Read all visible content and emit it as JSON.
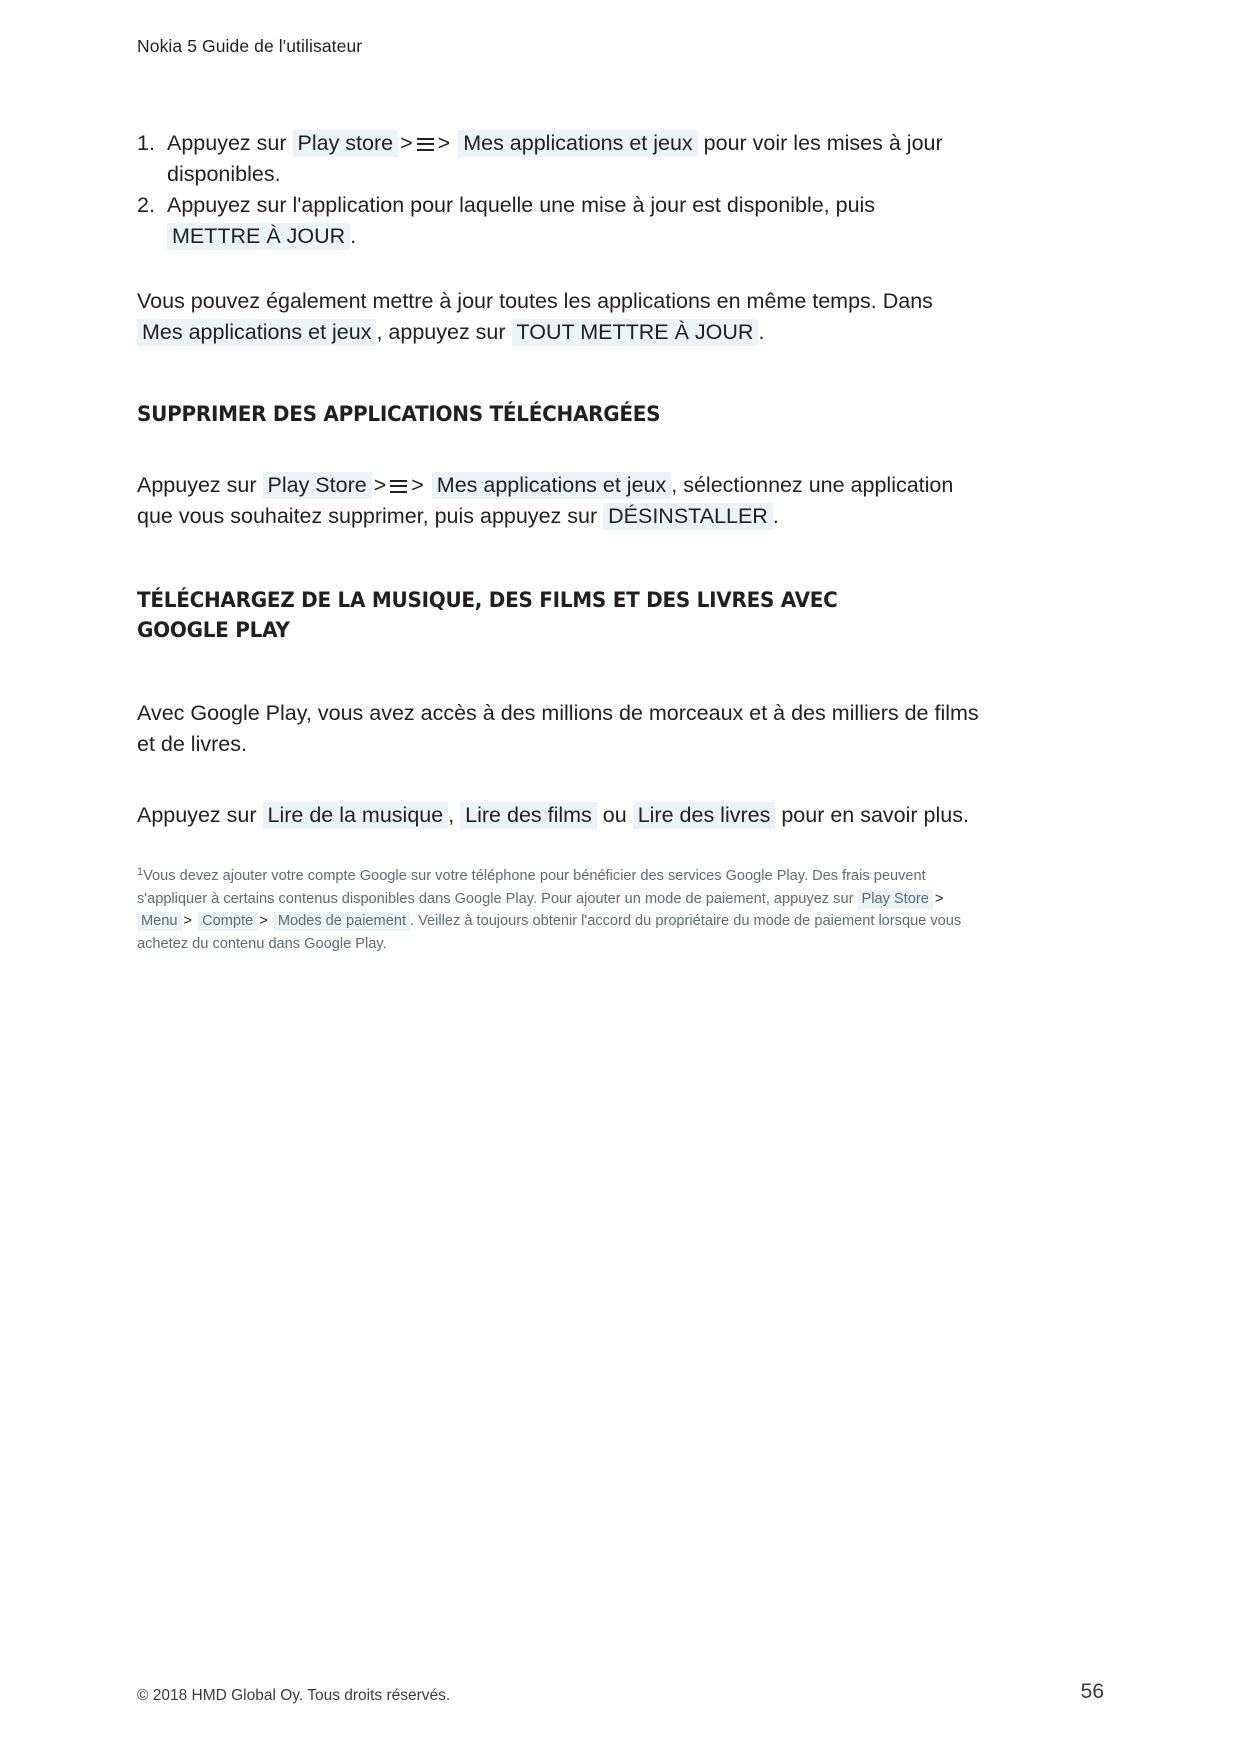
{
  "header": {
    "title": "Nokia 5 Guide de l'utilisateur"
  },
  "steps": [
    {
      "num": "1.",
      "lead": "Appuyez sur",
      "ui1": "Play store",
      "sep1": ">",
      "menu_icon": "hamburger-menu-icon",
      "sep2": ">",
      "ui2": "Mes applications et jeux",
      "tail": "pour voir les mises à jour disponibles."
    },
    {
      "num": "2.",
      "lead": "Appuyez sur l'application pour laquelle une mise à jour est disponible, puis",
      "ui1": "METTRE À JOUR",
      "tail": "."
    }
  ],
  "para_update_all": {
    "text1": "Vous pouvez également mettre à jour toutes les applications en même temps. Dans",
    "ui1": "Mes applications et jeux",
    "text2": ", appuyez sur",
    "ui2": "TOUT METTRE À JOUR",
    "text3": "."
  },
  "heading_remove": "SUPPRIMER DES APPLICATIONS TÉLÉCHARGÉES",
  "para_remove": {
    "text1": "Appuyez sur",
    "ui1": "Play Store",
    "sep1": ">",
    "menu_icon": "hamburger-menu-icon",
    "sep2": ">",
    "ui2": "Mes applications et jeux",
    "text2": ", sélectionnez une application que vous souhaitez supprimer, puis appuyez sur",
    "ui3": "DÉSINSTALLER",
    "text3": "."
  },
  "heading_download": "TÉLÉCHARGEZ DE LA MUSIQUE, DES FILMS ET DES LIVRES AVEC GOOGLE PLAY",
  "para_play": "Avec Google Play, vous avez accès à des millions de morceaux et à des milliers de films et de livres.",
  "para_tap": {
    "text1": "Appuyez sur",
    "ui1": "Lire de la musique",
    "text2": ",",
    "ui2": "Lire des films",
    "text3": "ou",
    "ui3": "Lire des livres",
    "text4": "pour en savoir plus."
  },
  "footnote": {
    "marker": "1",
    "text1": "Vous devez ajouter votre compte Google sur votre téléphone pour bénéficier des services Google Play. Des frais peuvent s'appliquer à certains contenus disponibles dans Google Play. Pour ajouter un mode de paiement, appuyez sur",
    "ui1": "Play Store",
    "sep1": ">",
    "ui2": "Menu",
    "sep2": ">",
    "ui3": "Compte",
    "sep3": ">",
    "ui4": "Modes de paiement",
    "text2": ". Veillez à toujours obtenir l'accord du propriétaire du mode de paiement lorsque vous achetez du contenu dans Google Play."
  },
  "footer": {
    "copyright": "© 2018 HMD Global Oy. Tous droits réservés.",
    "page_number": "56"
  },
  "colors": {
    "ui_highlight": "#e9f4f7",
    "body_text": "#231f20",
    "footnote_text": "#5d6b73"
  }
}
